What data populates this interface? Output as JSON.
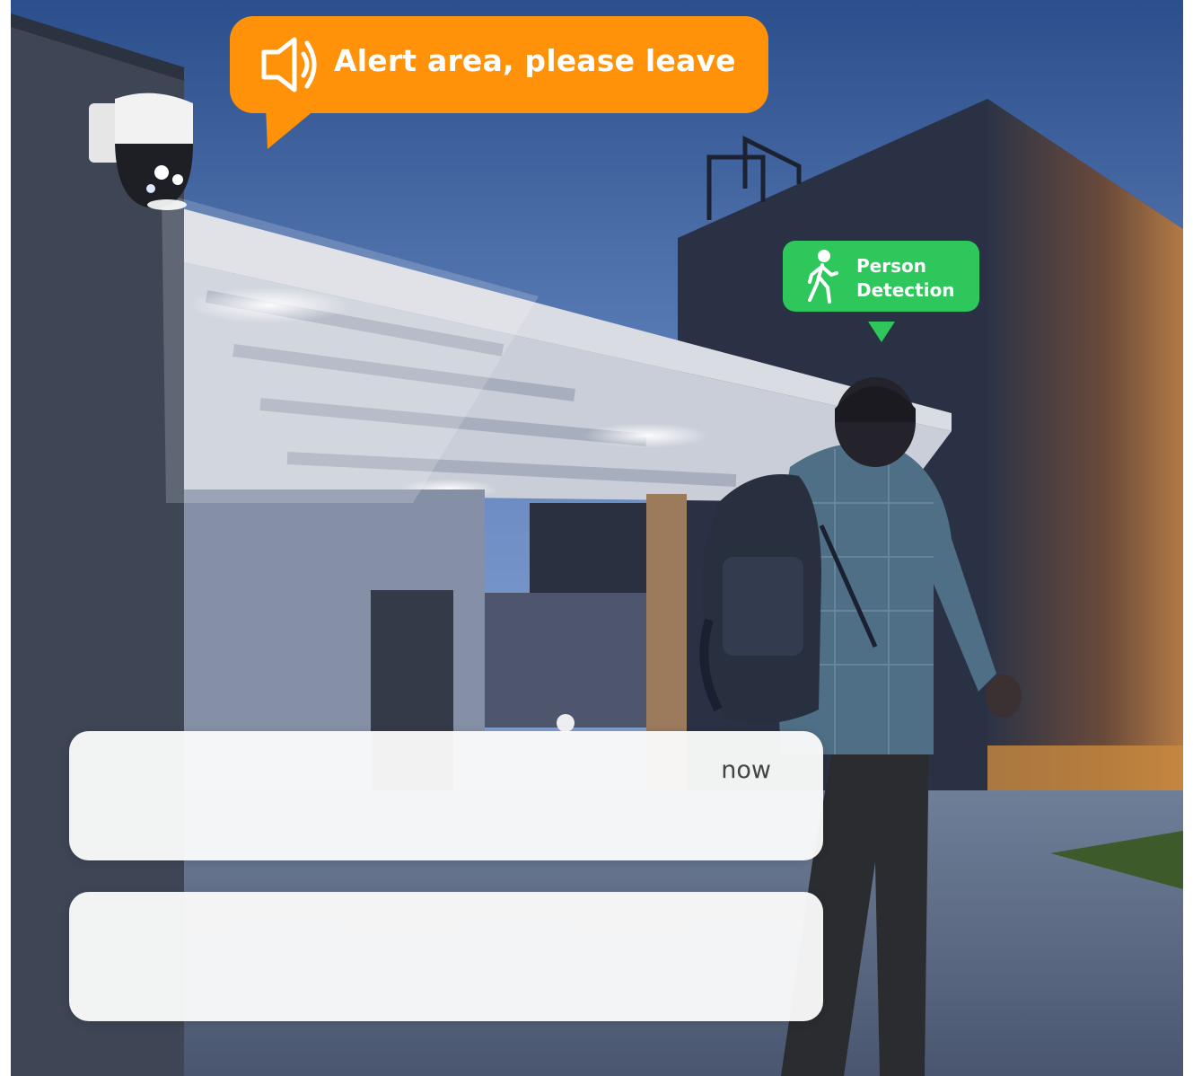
{
  "alert": {
    "text": "Alert area, please leave",
    "icon": "speaker-icon",
    "color": "#ff9208"
  },
  "detection": {
    "line1": "Person",
    "line2": "Detection",
    "icon": "walking-person-icon",
    "color": "#2ec75c"
  },
  "notifications": [
    {
      "time": "now"
    },
    {
      "time": ""
    }
  ]
}
